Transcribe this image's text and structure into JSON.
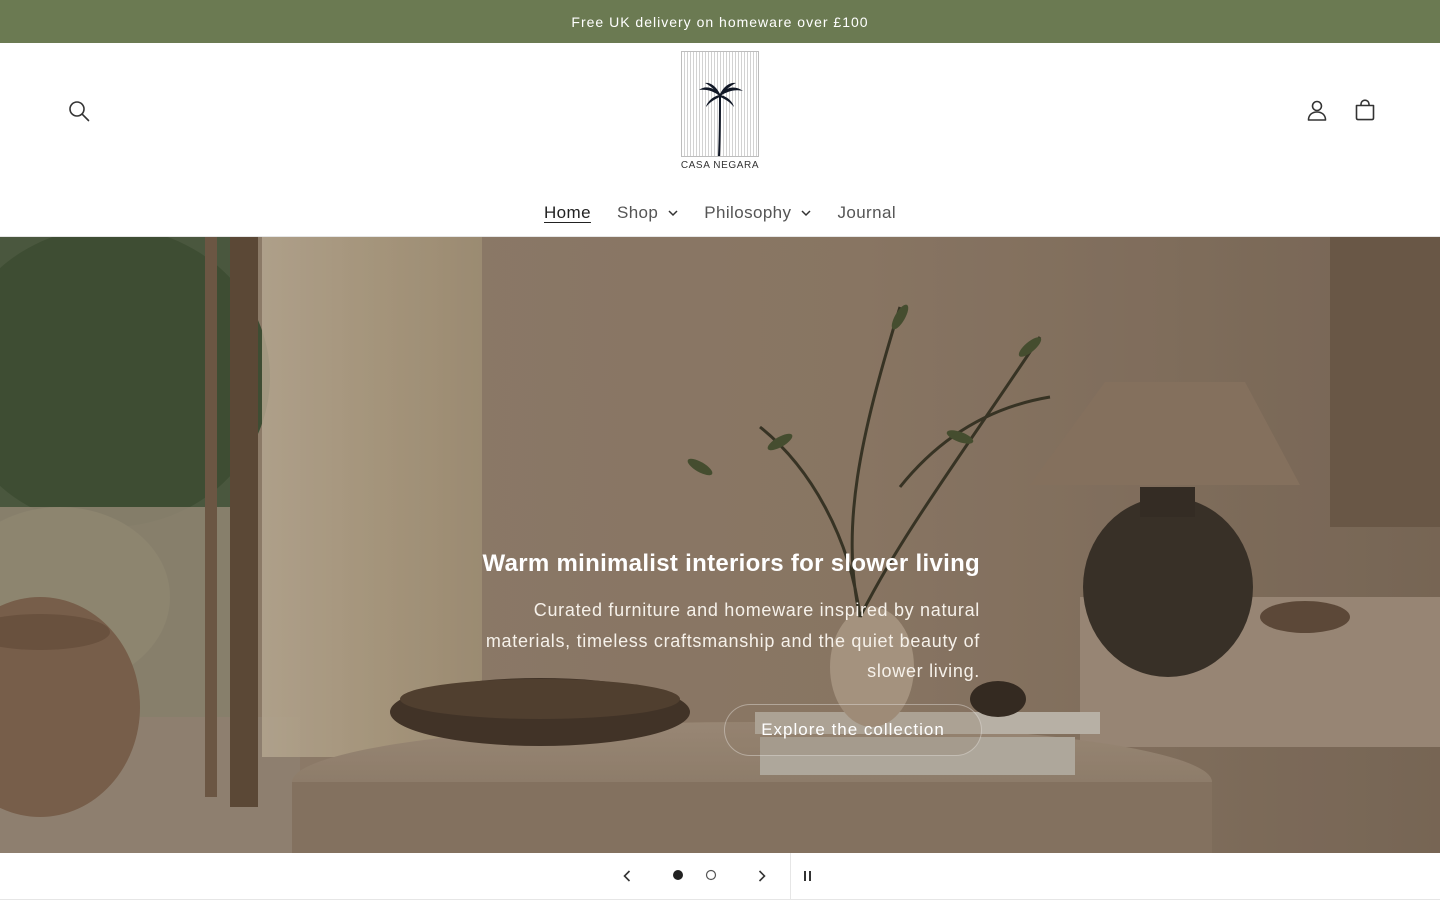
{
  "announcement": {
    "text": "Free UK delivery on homeware over £100",
    "background": "#6b7a52"
  },
  "header": {
    "logo_text": "CASA NEGARA",
    "icons": {
      "search": "search-icon",
      "account": "user-icon",
      "cart": "shopping-bag-icon"
    }
  },
  "nav": {
    "items": [
      {
        "label": "Home",
        "active": true
      },
      {
        "label": "Shop",
        "dropdown": true
      },
      {
        "label": "Philosophy",
        "dropdown": true
      },
      {
        "label": "Journal"
      }
    ]
  },
  "hero": {
    "title": "Warm minimalist interiors for slower living",
    "subtitle_lines": [
      "Curated furniture and homeware inspired by natural",
      "materials, timeless craftsmanship and the quiet beauty of",
      "slower living."
    ],
    "cta": "Explore the collection"
  },
  "slider": {
    "slide_count": 2,
    "current_slide": 1,
    "icons": {
      "prev": "chevron-left-icon",
      "next": "chevron-right-icon",
      "pause": "pause-icon"
    }
  },
  "colors": {
    "accent": "#6b7a52",
    "text": "#333333",
    "hero_text": "#ffffff"
  }
}
